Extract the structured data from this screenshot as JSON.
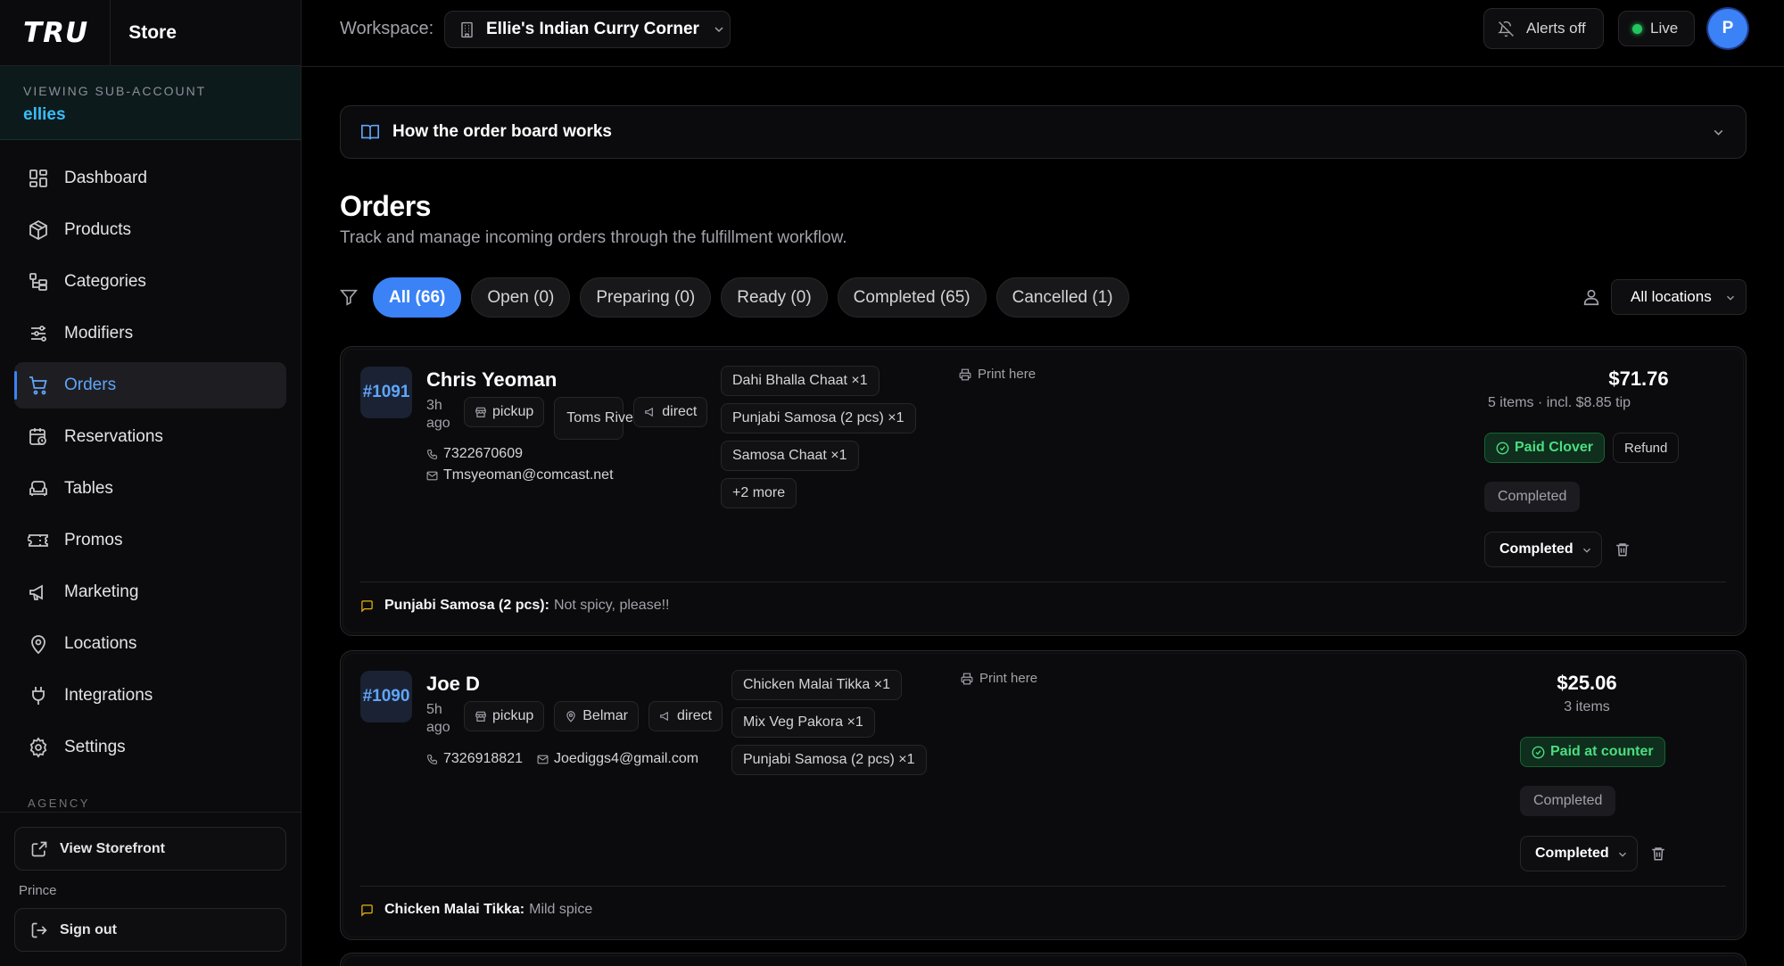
{
  "brand": {
    "logo": "TRU",
    "product": "Store"
  },
  "subaccount": {
    "label": "VIEWING SUB-ACCOUNT",
    "name": "ellies"
  },
  "nav": [
    {
      "label": "Dashboard",
      "icon": "dashboard-icon"
    },
    {
      "label": "Products",
      "icon": "box-icon"
    },
    {
      "label": "Categories",
      "icon": "categories-icon"
    },
    {
      "label": "Modifiers",
      "icon": "sliders-icon"
    },
    {
      "label": "Orders",
      "icon": "cart-icon",
      "active": true
    },
    {
      "label": "Reservations",
      "icon": "calendar-clock-icon"
    },
    {
      "label": "Tables",
      "icon": "armchair-icon"
    },
    {
      "label": "Promos",
      "icon": "ticket-icon"
    },
    {
      "label": "Marketing",
      "icon": "megaphone-icon"
    },
    {
      "label": "Locations",
      "icon": "map-pin-icon"
    },
    {
      "label": "Integrations",
      "icon": "plug-icon"
    },
    {
      "label": "Settings",
      "icon": "gear-icon"
    }
  ],
  "agency": {
    "label": "AGENCY",
    "view_storefront": "View Storefront",
    "user": "Prince",
    "sign_out": "Sign out"
  },
  "header": {
    "workspace_label": "Workspace:",
    "workspace_name": "Ellie's Indian Curry Corner",
    "alerts": "Alerts off",
    "live": "Live",
    "avatar_initial": "P"
  },
  "help": {
    "title": "How the order board works"
  },
  "page": {
    "title": "Orders",
    "subtitle": "Track and manage incoming orders through the fulfillment workflow."
  },
  "filters": [
    "All (66)",
    "Open (0)",
    "Preparing (0)",
    "Ready (0)",
    "Completed (65)",
    "Cancelled (1)"
  ],
  "location_filter": "All locations",
  "orders": [
    {
      "number": "#1091",
      "customer": "Chris Yeoman",
      "ago": "3h ago",
      "type": "pickup",
      "location": "Toms River",
      "channel": "direct",
      "phone": "7322670609",
      "email": "Tmsyeoman@comcast.net",
      "items": [
        "Dahi Bhalla Chaat ×1",
        "Punjabi Samosa (2 pcs) ×1",
        "Samosa Chaat ×1"
      ],
      "more": "+2 more",
      "print": "Print here",
      "total": "$71.76",
      "summary": "5 items · incl. $8.85 tip",
      "payment": "Paid Clover",
      "refund": "Refund",
      "status_pill": "Completed",
      "status": "Completed",
      "note_item": "Punjabi Samosa (2 pcs):",
      "note_text": "Not spicy, please!!"
    },
    {
      "number": "#1090",
      "customer": "Joe D",
      "ago": "5h ago",
      "type": "pickup",
      "location": "Belmar",
      "channel": "direct",
      "phone": "7326918821",
      "email": "Joediggs4@gmail.com",
      "items": [
        "Chicken Malai Tikka ×1",
        "Mix Veg Pakora ×1",
        "Punjabi Samosa (2 pcs) ×1"
      ],
      "print": "Print here",
      "total": "$25.06",
      "summary": "3 items",
      "payment": "Paid at counter",
      "status_pill": "Completed",
      "status": "Completed",
      "note_item": "Chicken Malai Tikka:",
      "note_text": "Mild spice"
    }
  ],
  "colors": {
    "accent": "#3b82f6",
    "paid": "#4ade80",
    "live": "#22c55e",
    "brand_sub": "#38bdf8"
  }
}
